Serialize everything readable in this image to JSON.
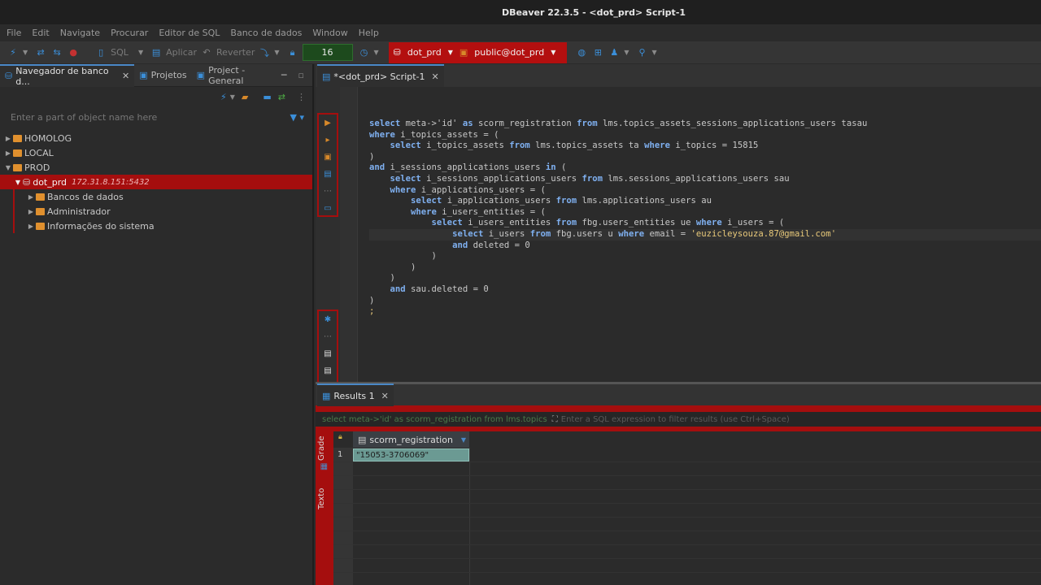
{
  "window": {
    "title": "DBeaver 22.3.5 - <dot_prd> Script-1"
  },
  "menu": [
    "File",
    "Edit",
    "Navigate",
    "Procurar",
    "Editor de SQL",
    "Banco de dados",
    "Window",
    "Help"
  ],
  "toolbar": {
    "sql_label": "SQL",
    "apply_label": "Aplicar",
    "revert_label": "Reverter",
    "counter": "16",
    "datasource": "dot_prd",
    "schema": "public@dot_prd"
  },
  "left_tabs": [
    {
      "label": "Navegador de banco d..."
    },
    {
      "label": "Projetos"
    },
    {
      "label": "Project - General"
    }
  ],
  "navigator": {
    "filter_placeholder": "Enter a part of object name here",
    "nodes": [
      "HOMOLOG",
      "LOCAL",
      "PROD"
    ],
    "connection": {
      "name": "dot_prd",
      "host": "172.31.8.151:5432"
    },
    "children": [
      "Bancos de dados",
      "Administrador",
      "Informações do sistema"
    ]
  },
  "editor": {
    "tab_label": "*<dot_prd> Script-1"
  },
  "results": {
    "tab_label": "Results 1",
    "query_preview": "select meta->'id' as scorm_registration from lms.topics",
    "filter_placeholder": "Enter a SQL expression to filter results (use Ctrl+Space)",
    "side_grid": "Grade",
    "side_text": "Texto",
    "column": "scorm_registration",
    "row_number": "1",
    "cell_value": "\"15053-3706069\""
  },
  "colors": {
    "accent_red": "#a50e0e",
    "keyword": "#7fb0f0",
    "string": "#e8c97a"
  }
}
